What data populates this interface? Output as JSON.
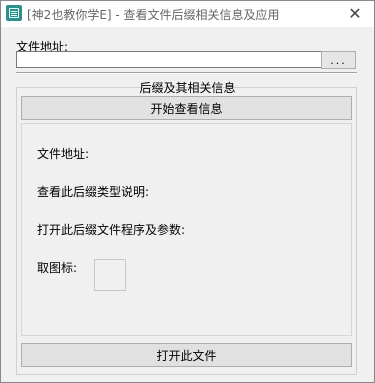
{
  "window": {
    "title": "[神2也教你学E] - 查看文件后缀相关信息及应用",
    "close_label": "✕"
  },
  "file": {
    "label": "文件地址:",
    "value": "",
    "browse_label": "..."
  },
  "info_group": {
    "title": "后缀及其相关信息",
    "start_button": "开始查看信息",
    "fields": {
      "path_label": "文件地址:",
      "type_label": "查看此后缀类型说明:",
      "open_label": "打开此后缀文件程序及参数:",
      "icon_label": "取图标:"
    }
  },
  "open_button": "打开此文件"
}
